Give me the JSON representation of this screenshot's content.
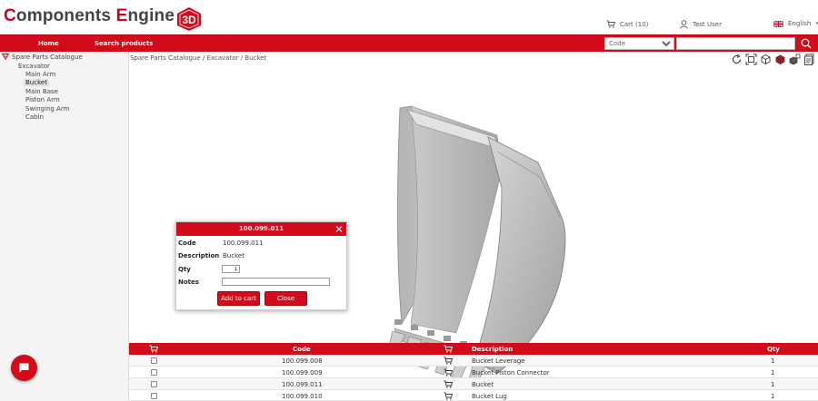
{
  "header": {
    "logo_parts": [
      "C",
      "omponents ",
      "E",
      "ngine"
    ],
    "logo_badge": "3D",
    "cart_label": "Cart (10)",
    "user_label": "Test User",
    "language_label": "English"
  },
  "nav": {
    "home": "Home",
    "search_products": "Search products",
    "search_field_selected": "Code",
    "search_placeholder": ""
  },
  "sidebar": {
    "root": "Spare Parts Catalogue",
    "group": "Excavator",
    "items": [
      "Main Arm",
      "Bucket",
      "Main Base",
      "Piston Arm",
      "Swinging Arm",
      "Cabin"
    ],
    "selected": "Bucket"
  },
  "breadcrumb": "Spare Parts Catalogue / Excavator / Bucket",
  "toolbar_icons": [
    "rotate-icon",
    "fit-view-icon",
    "view-cube-icon",
    "explode-icon",
    "material-icon",
    "export-icon"
  ],
  "dialog": {
    "title": "100.099.011",
    "code_label": "Code",
    "code_value": "100.099.011",
    "desc_label": "Description",
    "desc_value": "Bucket",
    "qty_label": "Qty",
    "qty_value": "1",
    "notes_label": "Notes",
    "notes_value": "",
    "add_button": "Add to cart",
    "close_button": "Close"
  },
  "table": {
    "headers": {
      "code": "Code",
      "description": "Description",
      "qty": "Qty"
    },
    "rows": [
      {
        "code": "100.099.008",
        "description": "Bucket Leverage",
        "qty": "1"
      },
      {
        "code": "100.099.009",
        "description": "Bucket Piston Connector",
        "qty": "1"
      },
      {
        "code": "100.099.011",
        "description": "Bucket",
        "qty": "1"
      },
      {
        "code": "100.099.010",
        "description": "Bucket Lug",
        "qty": "1"
      }
    ]
  },
  "colors": {
    "brand_red": "#d30a1a",
    "logo_dark": "#444444"
  }
}
